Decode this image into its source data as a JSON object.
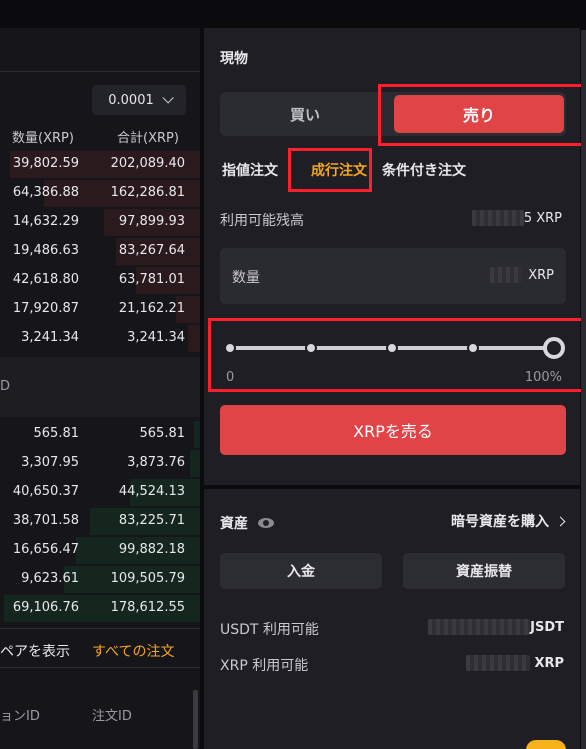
{
  "orderbook": {
    "precision": "0.0001",
    "col_amount": "数量(XRP)",
    "col_total": "合計(XRP)",
    "asks": [
      {
        "amount": "39,802.59",
        "total": "202,089.40",
        "depth": 0.95
      },
      {
        "amount": "64,386.88",
        "total": "162,286.81",
        "depth": 0.78
      },
      {
        "amount": "14,632.29",
        "total": "97,899.93",
        "depth": 0.48
      },
      {
        "amount": "19,486.63",
        "total": "83,267.64",
        "depth": 0.42
      },
      {
        "amount": "42,618.80",
        "total": "63,781.01",
        "depth": 0.32
      },
      {
        "amount": "17,920.87",
        "total": "21,162.21",
        "depth": 0.12
      },
      {
        "amount": "3,241.34",
        "total": "3,241.34",
        "depth": 0.06
      }
    ],
    "mid_label": "D",
    "bids": [
      {
        "amount": "565.81",
        "total": "565.81",
        "depth": 0.03
      },
      {
        "amount": "3,307.95",
        "total": "3,873.76",
        "depth": 0.05
      },
      {
        "amount": "40,650.37",
        "total": "44,524.13",
        "depth": 0.35
      },
      {
        "amount": "38,701.58",
        "total": "83,225.71",
        "depth": 0.55
      },
      {
        "amount": "16,656.47",
        "total": "99,882.18",
        "depth": 0.62
      },
      {
        "amount": "9,623.61",
        "total": "109,505.79",
        "depth": 0.68
      },
      {
        "amount": "69,106.76",
        "total": "178,612.55",
        "depth": 0.98
      }
    ]
  },
  "orders": {
    "pair_label": "ペアを表示",
    "all_orders": "すべての注文",
    "col_a": "ョンID",
    "col_b": "注文ID"
  },
  "trade": {
    "section_title": "現物",
    "buy_label": "買い",
    "sell_label": "売り",
    "tabs": [
      "指値注文",
      "成行注文",
      "条件付き注文"
    ],
    "active_tab": 1,
    "available_label": "利用可能残高",
    "available_suffix": "5 XRP",
    "qty_label": "数量",
    "qty_unit": "XRP",
    "slider_min": "0",
    "slider_max": "100%",
    "slider_value": 1.0,
    "submit_label": "XRPを売る"
  },
  "assets": {
    "title": "資産",
    "buy_crypto": "暗号資産を購入",
    "deposit": "入金",
    "transfer": "資産振替",
    "usdt_label": "USDT 利用可能",
    "usdt_suffix": "JSDT",
    "xrp_label": "XRP 利用可能",
    "xrp_suffix": "XRP"
  },
  "colors": {
    "sell": "#e04446",
    "accent": "#f5a623",
    "highlight": "#ff1f2f"
  }
}
